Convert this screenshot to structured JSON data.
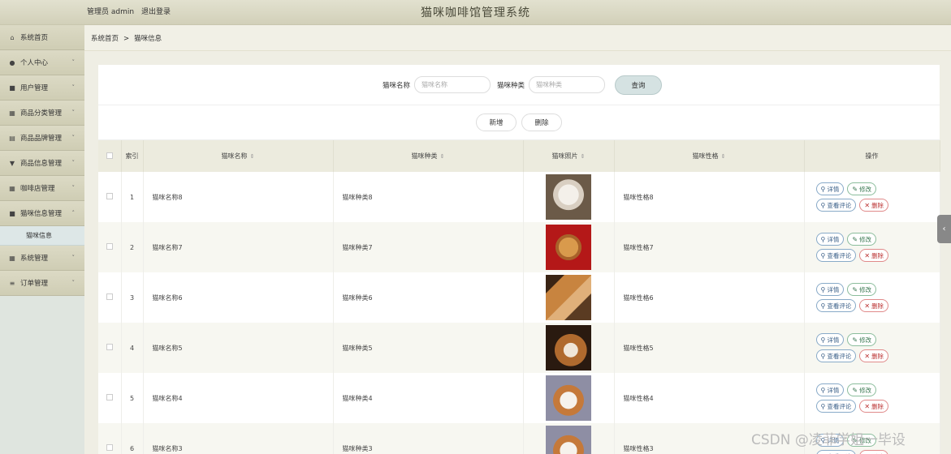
{
  "header": {
    "user_label": "管理员 admin",
    "logout": "退出登录",
    "title": "猫咪咖啡馆管理系统"
  },
  "sidebar": {
    "items": [
      {
        "label": "系统首页",
        "icon": "home-icon",
        "glyph": "⌂",
        "chevron": ""
      },
      {
        "label": "个人中心",
        "icon": "user-icon",
        "glyph": "●",
        "chevron": "˅"
      },
      {
        "label": "用户管理",
        "icon": "users-icon",
        "glyph": "■",
        "chevron": "˅"
      },
      {
        "label": "商品分类管理",
        "icon": "grid-icon",
        "glyph": "▦",
        "chevron": "˅"
      },
      {
        "label": "商品品牌管理",
        "icon": "tag-icon",
        "glyph": "▤",
        "chevron": "˅"
      },
      {
        "label": "商品信息管理",
        "icon": "funnel-icon",
        "glyph": "▼",
        "chevron": "˅"
      },
      {
        "label": "咖啡店管理",
        "icon": "grid-icon",
        "glyph": "▦",
        "chevron": "˅"
      },
      {
        "label": "猫咪信息管理",
        "icon": "book-icon",
        "glyph": "■",
        "chevron": "˄"
      }
    ],
    "sub_item": "猫咪信息",
    "items_after": [
      {
        "label": "系统管理",
        "icon": "grid-icon",
        "glyph": "▦",
        "chevron": "˅"
      },
      {
        "label": "订单管理",
        "icon": "list-icon",
        "glyph": "≡",
        "chevron": "˅"
      }
    ]
  },
  "breadcrumb": {
    "home": "系统首页",
    "sep": ">",
    "current": "猫咪信息"
  },
  "search": {
    "name_label": "猫咪名称",
    "name_placeholder": "猫咪名称",
    "type_label": "猫咪种类",
    "type_placeholder": "猫咪种类",
    "query_button": "查询"
  },
  "toolbar": {
    "add": "新增",
    "delete": "删除"
  },
  "table": {
    "headers": {
      "index": "索引",
      "name": "猫咪名称",
      "type": "猫咪种类",
      "photo": "猫咪照片",
      "personality": "猫咪性格",
      "ops": "操作"
    },
    "sort_glyph": "⇕",
    "rows": [
      {
        "index": "1",
        "name": "猫咪名称8",
        "type": "猫咪种类8",
        "personality": "猫咪性格8",
        "photo": "white-poodle"
      },
      {
        "index": "2",
        "name": "猫咪名称7",
        "type": "猫咪种类7",
        "personality": "猫咪性格7",
        "photo": "golden-puppy-red"
      },
      {
        "index": "3",
        "name": "猫咪名称6",
        "type": "猫咪种类6",
        "personality": "猫咪性格6",
        "photo": "dog-and-cat"
      },
      {
        "index": "4",
        "name": "猫咪名称5",
        "type": "猫咪种类5",
        "personality": "猫咪性格5",
        "photo": "husky-dog"
      },
      {
        "index": "5",
        "name": "猫咪名称4",
        "type": "猫咪种类4",
        "personality": "猫咪性格4",
        "photo": "papillon-dog"
      },
      {
        "index": "6",
        "name": "猫咪名称3",
        "type": "猫咪种类3",
        "personality": "猫咪性格3",
        "photo": "papillon-dog-2"
      }
    ],
    "ops": {
      "detail": "详情",
      "edit": "修改",
      "comments": "查看评论",
      "remove": "删除"
    }
  },
  "watermark": "CSDN @凌菲学姐一毕设"
}
